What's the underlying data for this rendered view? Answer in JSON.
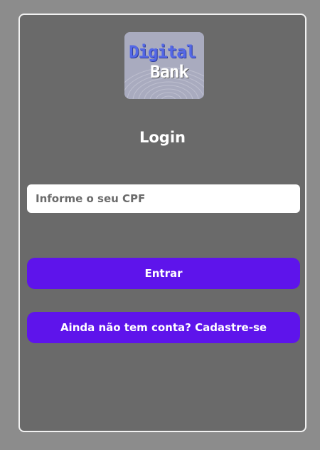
{
  "logo": {
    "word1": "Digital",
    "word2": "Bank"
  },
  "login": {
    "title": "Login",
    "cpf_placeholder": "Informe o seu CPF",
    "cpf_value": "",
    "enter_label": "Entrar",
    "signup_label": "Ainda não tem conta? Cadastre-se"
  },
  "colors": {
    "page_background": "#8c8c8c",
    "card_background": "#6a6a6a",
    "button": "#5e14eb",
    "logo_blue": "#5468e6"
  }
}
